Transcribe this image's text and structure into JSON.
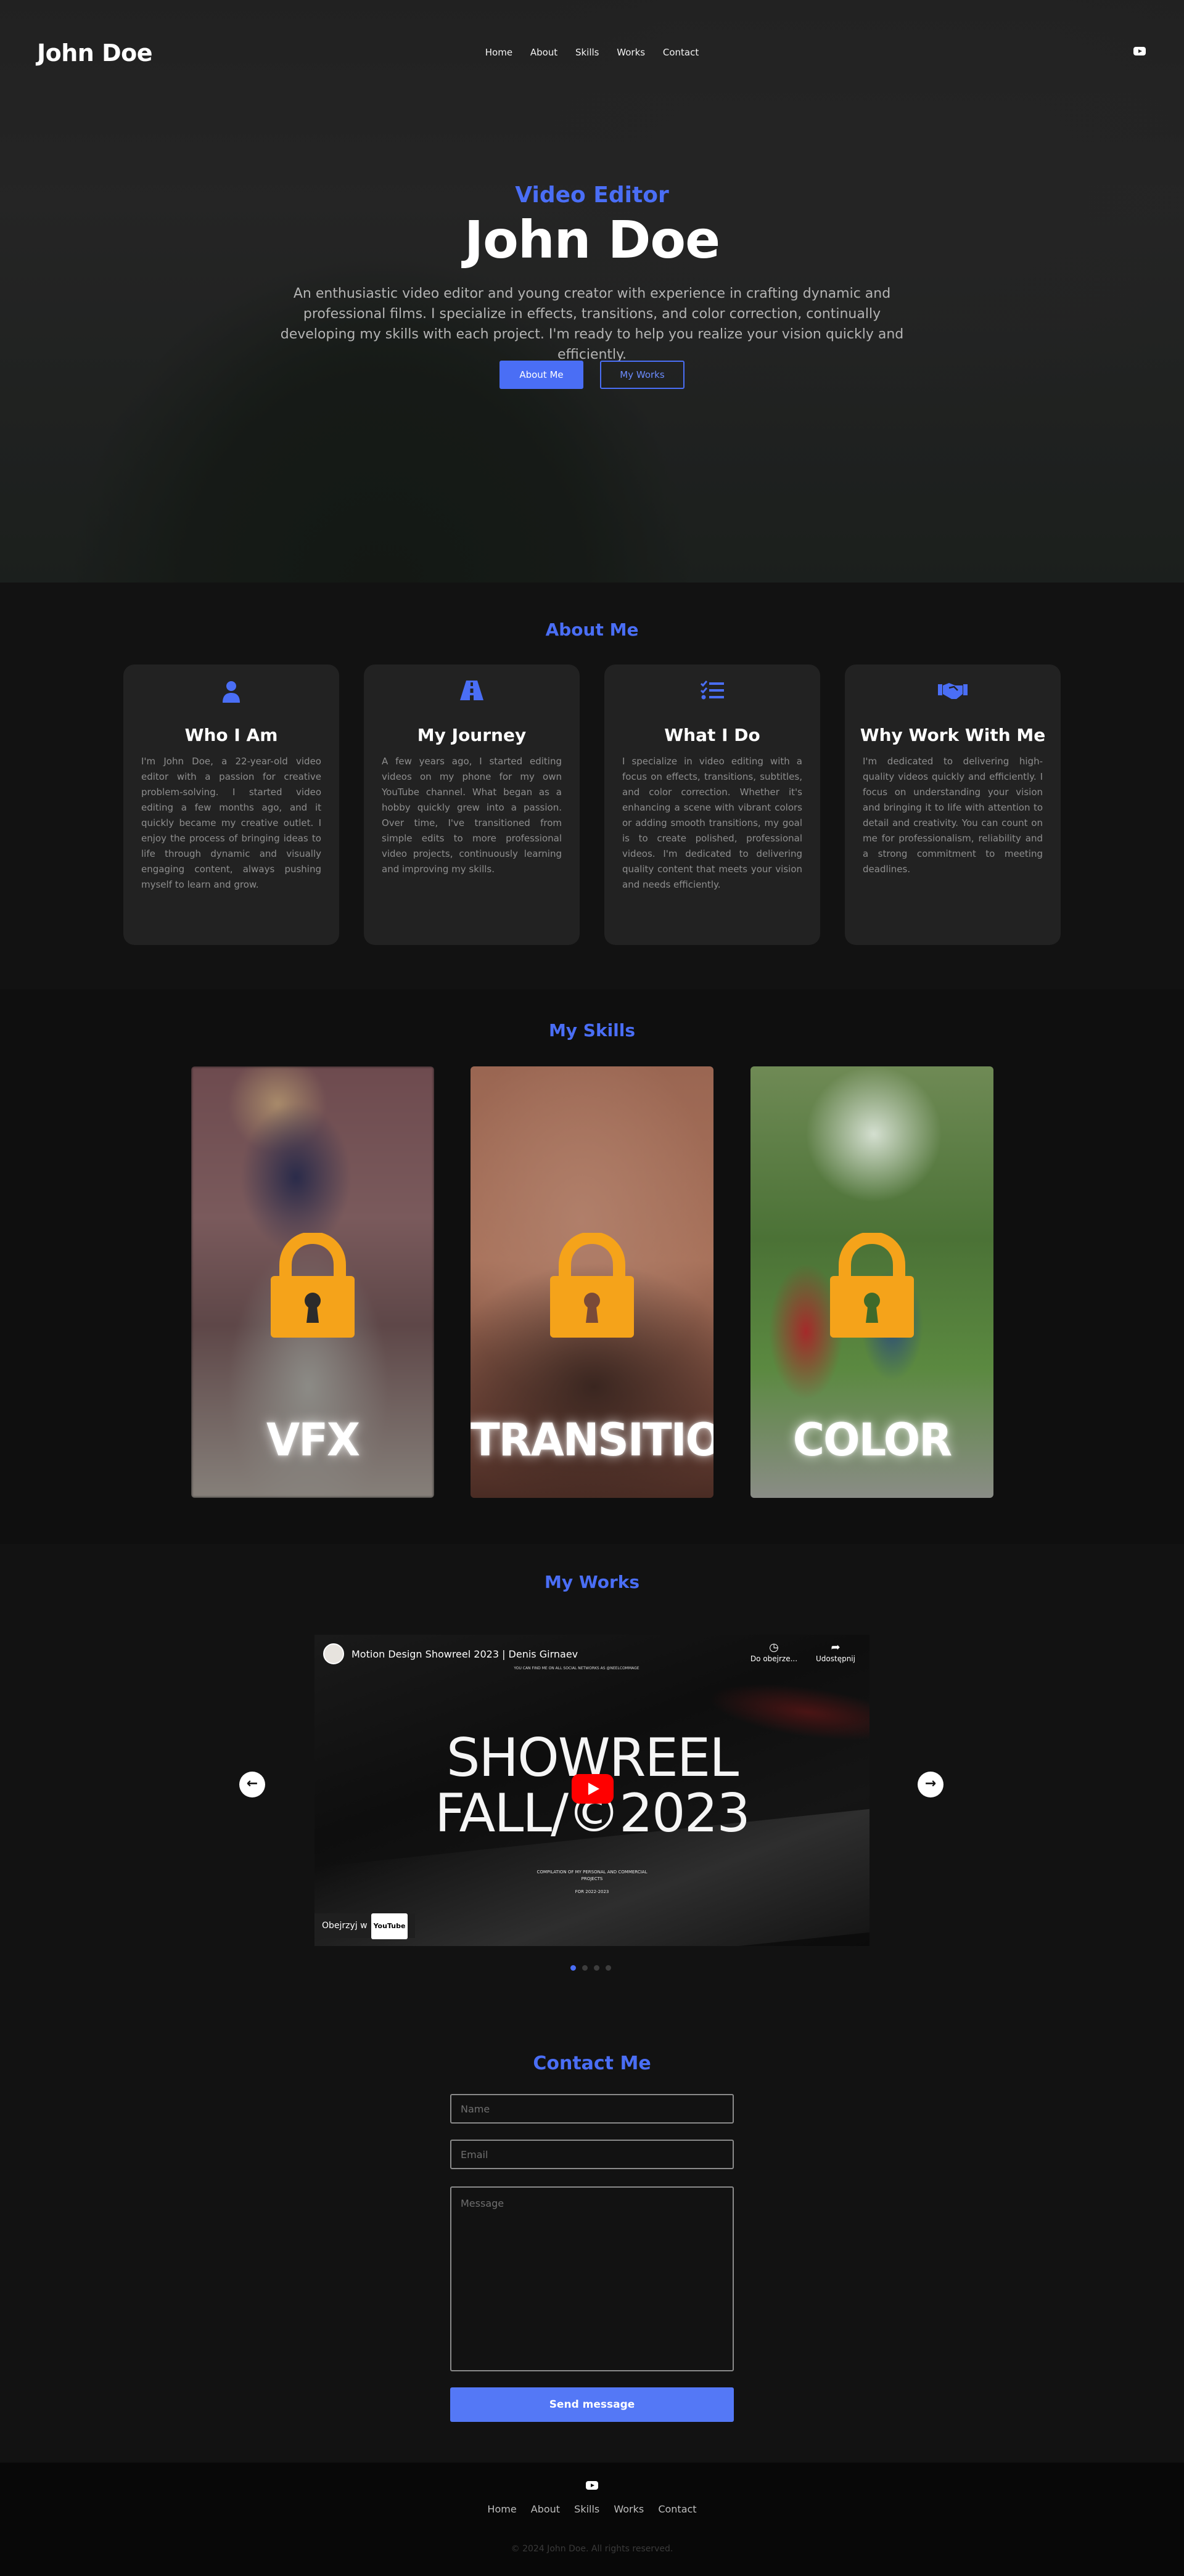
{
  "nav": {
    "brand": "John Doe",
    "links": [
      "Home",
      "About",
      "Skills",
      "Works",
      "Contact"
    ],
    "social_icon": "youtube-icon"
  },
  "hero": {
    "subtitle": "Video Editor",
    "title": "John Doe",
    "description": "An enthusiastic video editor and young creator with experience in crafting dynamic and professional films. I specialize in effects, transitions, and color correction, continually developing my skills with each project. I'm ready to help you realize your vision quickly and efficiently.",
    "about_button": "About Me",
    "works_button": "My Works"
  },
  "about": {
    "title": "About Me",
    "cards": [
      {
        "icon": "user-icon",
        "heading": "Who I Am",
        "text": "I'm John Doe, a 22-year-old video editor with a passion for creative problem-solving. I started video editing a few months ago, and it quickly became my creative outlet. I enjoy the process of bringing ideas to life through dynamic and visually engaging content, always pushing myself to learn and grow."
      },
      {
        "icon": "road-icon",
        "heading": "My Journey",
        "text": "A few years ago, I started editing videos on my phone for my own YouTube channel. What began as a hobby quickly grew into a passion. Over time, I've transitioned from simple edits to more professional video projects, continuously learning and improving my skills."
      },
      {
        "icon": "list-check-icon",
        "heading": "What I Do",
        "text": "I specialize in video editing with a focus on effects, transitions, subtitles, and color correction. Whether it's enhancing a scene with vibrant colors or adding smooth transitions, my goal is to create polished, professional videos. I'm dedicated to delivering quality content that meets your vision and needs efficiently."
      },
      {
        "icon": "handshake-icon",
        "heading": "Why Work With Me",
        "text": "I'm dedicated to delivering high-quality videos quickly and efficiently. I focus on understanding your vision and bringing it to life with attention to detail and creativity. You can count on me for professionalism, reliability and a strong commitment to meeting deadlines."
      }
    ]
  },
  "skills": {
    "title": "My Skills",
    "items": [
      {
        "label": "VFX",
        "icon": "lock-icon"
      },
      {
        "label": "TRANSITION",
        "icon": "lock-icon"
      },
      {
        "label": "COLOR",
        "icon": "lock-icon"
      }
    ]
  },
  "works": {
    "title": "My Works",
    "video": {
      "title": "Motion Design Showreel 2023 | Denis Girnaev",
      "watch_later": "Do obejrze...",
      "share": "Udostępnij",
      "top_caption": "YOU CAN FIND ME ON ALL SOCIAL NETWORKS AS @NEELCOMMAGE",
      "headline_1": "SHOWREEL",
      "headline_2": "FALL/©2023",
      "caption_1": "COMPILATION OF MY PERSONAL AND COMMERCIAL PROJECTS",
      "caption_2": "FOR 2022-2023",
      "watch_on": "Obejrzyj w",
      "youtube_label": "YouTube"
    },
    "prev_arrow": "←",
    "next_arrow": "→",
    "slide_count": 4,
    "active_slide": 1
  },
  "contact": {
    "title": "Contact Me",
    "name_placeholder": "Name",
    "email_placeholder": "Email",
    "message_placeholder": "Message",
    "send_button": "Send message"
  },
  "footer": {
    "links": [
      "Home",
      "About",
      "Skills",
      "Works",
      "Contact"
    ],
    "copyright": "© 2024 John Doe. All rights reserved."
  },
  "colors": {
    "accent": "#4a6ef5",
    "lock": "#f5a31a",
    "background": "#0f0f0f",
    "card": "#222222"
  }
}
